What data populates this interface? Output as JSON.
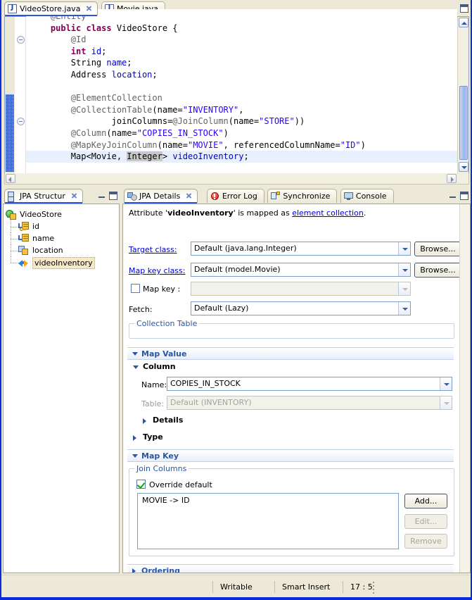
{
  "editor": {
    "tabs": [
      {
        "label": "VideoStore.java",
        "icon": "java-file-icon",
        "active": true,
        "closable": true
      },
      {
        "label": "Movie.java",
        "icon": "java-file-icon",
        "active": false,
        "closable": false
      }
    ],
    "minimize_tooltip": "Minimize",
    "maximize_tooltip": "Maximize",
    "code_lines": [
      {
        "id": "l1",
        "segments": [
          {
            "t": "    ",
            "c": "plain"
          },
          {
            "t": "@Entity",
            "c": "ann"
          }
        ]
      },
      {
        "id": "l2",
        "segments": [
          {
            "t": "    ",
            "c": "plain"
          },
          {
            "t": "public class",
            "c": "kw"
          },
          {
            "t": " VideoStore {",
            "c": "plain"
          }
        ]
      },
      {
        "id": "l3",
        "segments": [
          {
            "t": "        ",
            "c": "plain"
          },
          {
            "t": "@Id",
            "c": "ann"
          }
        ]
      },
      {
        "id": "l4",
        "segments": [
          {
            "t": "        ",
            "c": "plain"
          },
          {
            "t": "int",
            "c": "kw"
          },
          {
            "t": " ",
            "c": "plain"
          },
          {
            "t": "id",
            "c": "fld"
          },
          {
            "t": ";",
            "c": "plain"
          }
        ]
      },
      {
        "id": "l5",
        "segments": [
          {
            "t": "        String ",
            "c": "plain"
          },
          {
            "t": "name",
            "c": "fld"
          },
          {
            "t": ";",
            "c": "plain"
          }
        ]
      },
      {
        "id": "l6",
        "segments": [
          {
            "t": "        Address ",
            "c": "plain"
          },
          {
            "t": "location",
            "c": "fld"
          },
          {
            "t": ";",
            "c": "plain"
          }
        ]
      },
      {
        "id": "l7",
        "segments": [
          {
            "t": "",
            "c": "plain"
          }
        ]
      },
      {
        "id": "l8",
        "segments": [
          {
            "t": "        ",
            "c": "plain"
          },
          {
            "t": "@ElementCollection",
            "c": "ann"
          }
        ]
      },
      {
        "id": "l9",
        "segments": [
          {
            "t": "        ",
            "c": "plain"
          },
          {
            "t": "@CollectionTable",
            "c": "ann"
          },
          {
            "t": "(name=",
            "c": "plain"
          },
          {
            "t": "\"INVENTORY\"",
            "c": "str"
          },
          {
            "t": ",",
            "c": "plain"
          }
        ]
      },
      {
        "id": "l10",
        "segments": [
          {
            "t": "                joinColumns=",
            "c": "plain"
          },
          {
            "t": "@JoinColumn",
            "c": "ann"
          },
          {
            "t": "(name=",
            "c": "plain"
          },
          {
            "t": "\"STORE\"",
            "c": "str"
          },
          {
            "t": "))",
            "c": "plain"
          }
        ]
      },
      {
        "id": "l11",
        "segments": [
          {
            "t": "        ",
            "c": "plain"
          },
          {
            "t": "@Column",
            "c": "ann"
          },
          {
            "t": "(name=",
            "c": "plain"
          },
          {
            "t": "\"COPIES_IN_STOCK\"",
            "c": "str"
          },
          {
            "t": ")",
            "c": "plain"
          }
        ]
      },
      {
        "id": "l12",
        "segments": [
          {
            "t": "        ",
            "c": "plain"
          },
          {
            "t": "@MapKeyJoinColumn",
            "c": "ann"
          },
          {
            "t": "(name=",
            "c": "plain"
          },
          {
            "t": "\"MOVIE\"",
            "c": "str"
          },
          {
            "t": ", referencedColumnName=",
            "c": "plain"
          },
          {
            "t": "\"ID\"",
            "c": "str"
          },
          {
            "t": ")",
            "c": "plain"
          }
        ]
      },
      {
        "id": "l13",
        "highlight": true,
        "segments": [
          {
            "t": "        Map<Movie, ",
            "c": "plain"
          },
          {
            "t": "Integer",
            "c": "sel"
          },
          {
            "t": "> ",
            "c": "plain"
          },
          {
            "t": "videoInventory",
            "c": "fld"
          },
          {
            "t": ";",
            "c": "plain"
          }
        ]
      }
    ]
  },
  "structure_view": {
    "tab_label": "JPA Structur",
    "tab_icon": "jpa-structure-icon",
    "tree": [
      {
        "label": "VideoStore",
        "icon": "entity-icon",
        "depth": 0,
        "expander": "collapse",
        "selected": false
      },
      {
        "label": "id",
        "icon": "id-field-icon",
        "depth": 1,
        "expander": "none",
        "selected": false
      },
      {
        "label": "name",
        "icon": "basic-field-icon",
        "depth": 1,
        "expander": "none",
        "selected": false
      },
      {
        "label": "location",
        "icon": "embedded-field-icon",
        "depth": 1,
        "expander": "none",
        "selected": false
      },
      {
        "label": "videoInventory",
        "icon": "element-collection-icon",
        "depth": 1,
        "expander": "none",
        "selected": true
      }
    ]
  },
  "details_view": {
    "tabs": [
      {
        "label": "JPA Details",
        "icon": "jpa-details-icon",
        "active": true,
        "closable": true
      },
      {
        "label": "Error Log",
        "icon": "error-log-icon",
        "active": false,
        "closable": false
      },
      {
        "label": "Synchronize",
        "icon": "synchronize-icon",
        "active": false,
        "closable": false
      },
      {
        "label": "Console",
        "icon": "console-icon",
        "active": false,
        "closable": false
      }
    ],
    "header": {
      "prefix": "Attribute '",
      "attribute": "videoInventory",
      "middle": "' is mapped as ",
      "link": "element collection",
      "suffix": "."
    },
    "fields": {
      "target_class_label": "Target class:",
      "target_class_value": "Default (java.lang.Integer)",
      "target_class_browse": "Browse...",
      "map_key_class_label": "Map key class:",
      "map_key_class_value": "Default (model.Movie)",
      "map_key_class_browse": "Browse...",
      "map_key_checkbox_label": "Map key :",
      "map_key_checked": false,
      "map_key_value": "",
      "fetch_label": "Fetch:",
      "fetch_value": "Default (Lazy)"
    },
    "collection_table": {
      "group_title": "Collection Table"
    },
    "map_value": {
      "section_title": "Map Value",
      "column_sub": "Column",
      "name_label": "Name:",
      "name_value": "COPIES_IN_STOCK",
      "table_label": "Table:",
      "table_value": "Default (INVENTORY)",
      "table_disabled": true,
      "details_sub": "Details",
      "type_sub": "Type"
    },
    "map_key": {
      "section_title": "Map Key",
      "join_columns_group": "Join Columns",
      "override_default_label": "Override default",
      "override_default_checked": true,
      "join_column_items": [
        "MOVIE -> ID"
      ],
      "add_button": "Add...",
      "edit_button": "Edit...",
      "edit_disabled": true,
      "remove_button": "Remove",
      "remove_disabled": true
    },
    "ordering": {
      "section_title": "Ordering"
    }
  },
  "status_bar": {
    "writable": "Writable",
    "insert_mode": "Smart Insert",
    "position": "17 : 5"
  },
  "colors": {
    "window_border": "#0a2ddb",
    "chrome": "#ece9d8",
    "accent_link": "#0000cc",
    "section_header_text": "#2a55a5",
    "selection_highlight": "#f5e9c8",
    "code_keyword": "#7f0055",
    "code_string": "#2a00ff",
    "code_annotation": "#646464",
    "code_field": "#0000c0"
  }
}
